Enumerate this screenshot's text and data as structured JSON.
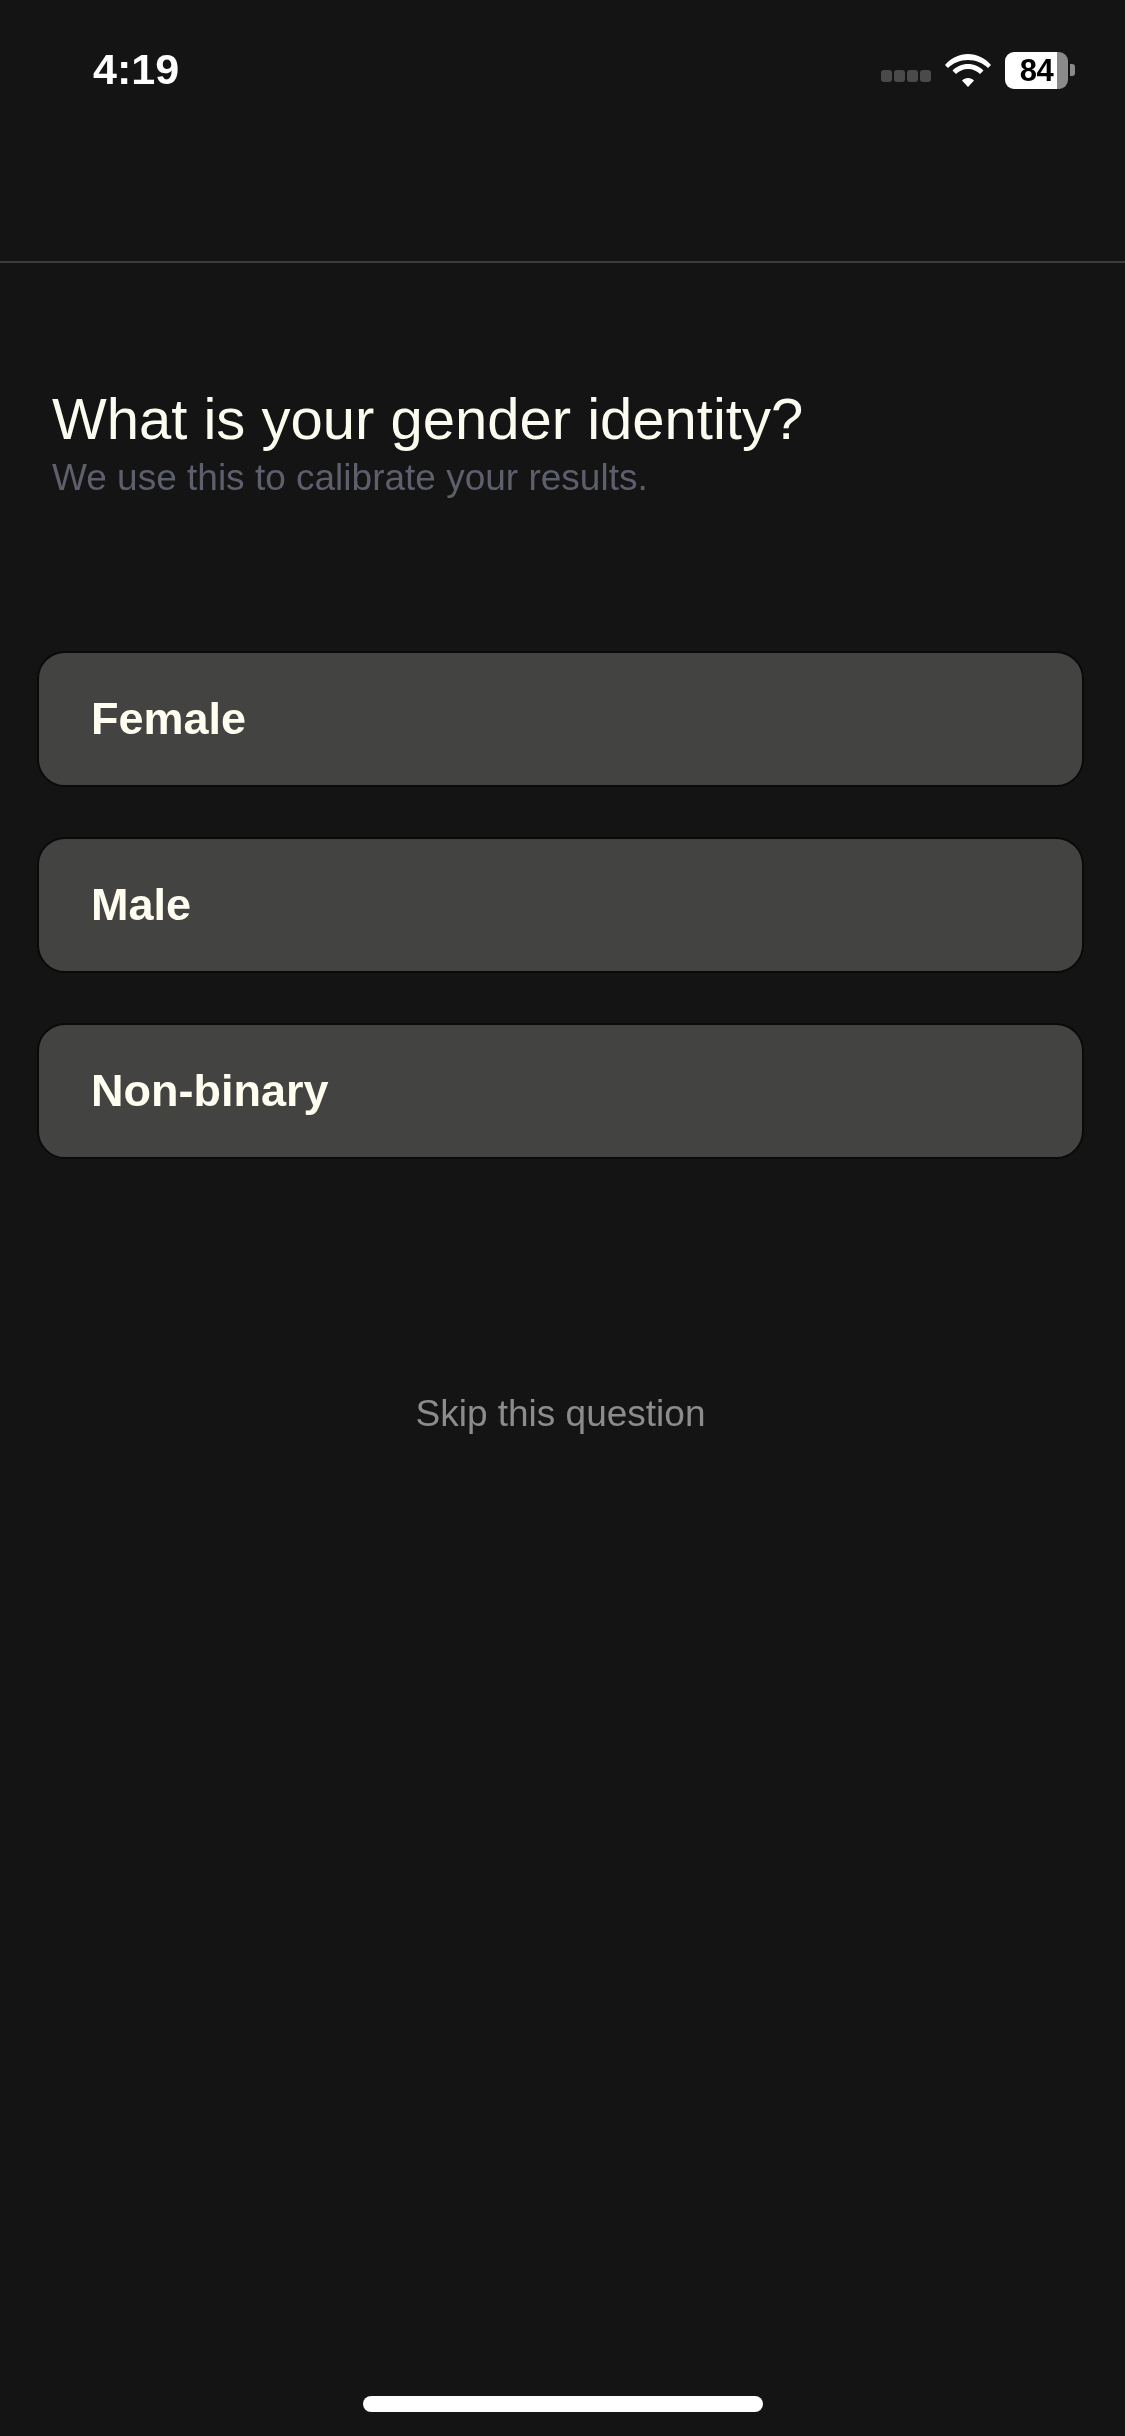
{
  "status_bar": {
    "time": "4:19",
    "battery": "84"
  },
  "question": {
    "title": "What is your gender identity?",
    "subtitle": "We use this to calibrate your results."
  },
  "options": [
    {
      "label": "Female",
      "selected": false
    },
    {
      "label": "Male",
      "selected": false
    },
    {
      "label": "Non-binary",
      "selected": false
    }
  ],
  "skip": {
    "label": "Skip this question"
  }
}
